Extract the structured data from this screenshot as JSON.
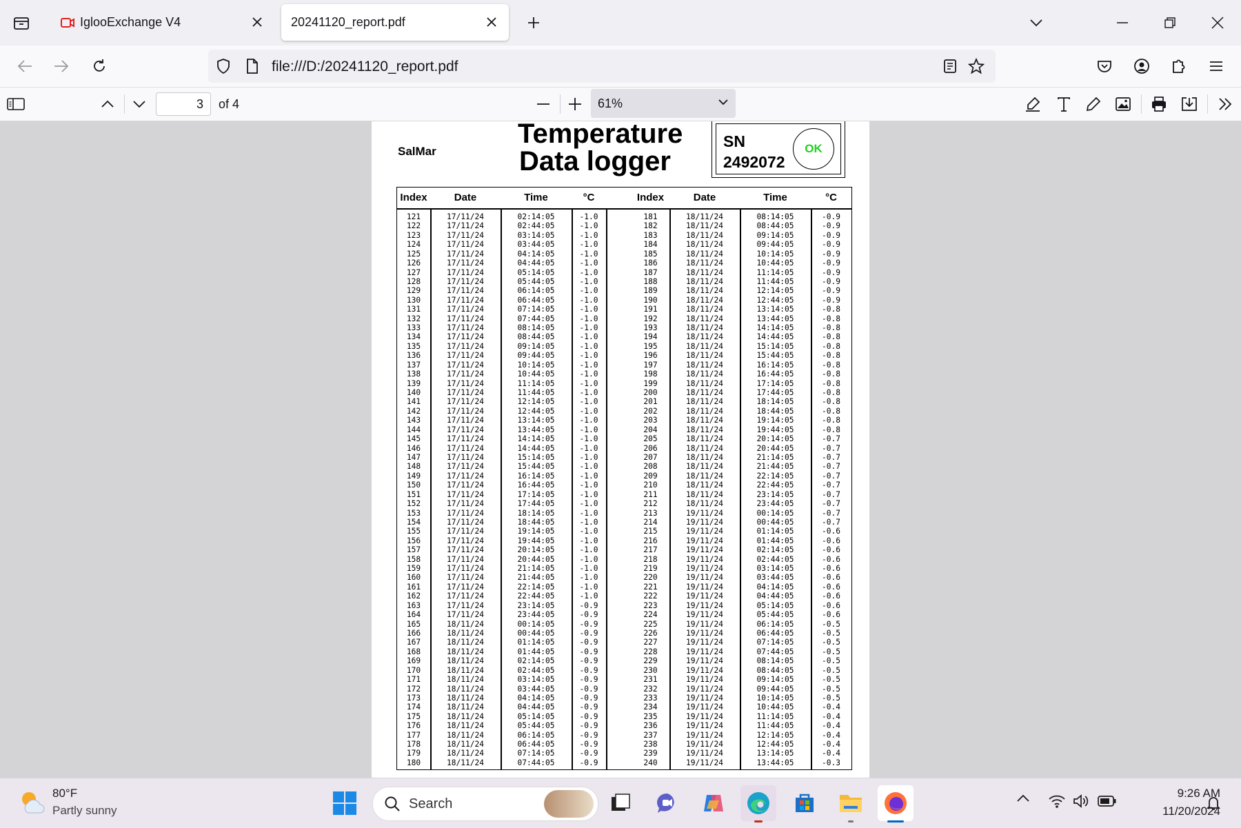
{
  "tabs": [
    {
      "title": "IglooExchange V4",
      "active": false
    },
    {
      "title": "20241120_report.pdf",
      "active": true
    }
  ],
  "url": "file:///D:/20241120_report.pdf",
  "pdf_toolbar": {
    "page": "3",
    "page_of": "of 4",
    "zoom": "61%"
  },
  "document": {
    "company": "SalMar",
    "title_line1": "Temperature",
    "title_line2": "Data logger",
    "sn_label": "SN",
    "sn_number": "2492072",
    "status": "OK",
    "headers": [
      "Index",
      "Date",
      "Time",
      "°C",
      "Index",
      "Date",
      "Time",
      "°C"
    ],
    "left": {
      "index": "121\n122\n123\n124\n125\n126\n127\n128\n129\n130\n131\n132\n133\n134\n135\n136\n137\n138\n139\n140\n141\n142\n143\n144\n145\n146\n147\n148\n149\n150\n151\n152\n153\n154\n155\n156\n157\n158\n159\n160\n161\n162\n163\n164\n165\n166\n167\n168\n169\n170\n171\n172\n173\n174\n175\n176\n177\n178\n179\n180",
      "date": "17/11/24\n17/11/24\n17/11/24\n17/11/24\n17/11/24\n17/11/24\n17/11/24\n17/11/24\n17/11/24\n17/11/24\n17/11/24\n17/11/24\n17/11/24\n17/11/24\n17/11/24\n17/11/24\n17/11/24\n17/11/24\n17/11/24\n17/11/24\n17/11/24\n17/11/24\n17/11/24\n17/11/24\n17/11/24\n17/11/24\n17/11/24\n17/11/24\n17/11/24\n17/11/24\n17/11/24\n17/11/24\n17/11/24\n17/11/24\n17/11/24\n17/11/24\n17/11/24\n17/11/24\n17/11/24\n17/11/24\n17/11/24\n17/11/24\n17/11/24\n17/11/24\n18/11/24\n18/11/24\n18/11/24\n18/11/24\n18/11/24\n18/11/24\n18/11/24\n18/11/24\n18/11/24\n18/11/24\n18/11/24\n18/11/24\n18/11/24\n18/11/24\n18/11/24\n18/11/24",
      "time": "02:14:05\n02:44:05\n03:14:05\n03:44:05\n04:14:05\n04:44:05\n05:14:05\n05:44:05\n06:14:05\n06:44:05\n07:14:05\n07:44:05\n08:14:05\n08:44:05\n09:14:05\n09:44:05\n10:14:05\n10:44:05\n11:14:05\n11:44:05\n12:14:05\n12:44:05\n13:14:05\n13:44:05\n14:14:05\n14:44:05\n15:14:05\n15:44:05\n16:14:05\n16:44:05\n17:14:05\n17:44:05\n18:14:05\n18:44:05\n19:14:05\n19:44:05\n20:14:05\n20:44:05\n21:14:05\n21:44:05\n22:14:05\n22:44:05\n23:14:05\n23:44:05\n00:14:05\n00:44:05\n01:14:05\n01:44:05\n02:14:05\n02:44:05\n03:14:05\n03:44:05\n04:14:05\n04:44:05\n05:14:05\n05:44:05\n06:14:05\n06:44:05\n07:14:05\n07:44:05",
      "temp": "-1.0\n-1.0\n-1.0\n-1.0\n-1.0\n-1.0\n-1.0\n-1.0\n-1.0\n-1.0\n-1.0\n-1.0\n-1.0\n-1.0\n-1.0\n-1.0\n-1.0\n-1.0\n-1.0\n-1.0\n-1.0\n-1.0\n-1.0\n-1.0\n-1.0\n-1.0\n-1.0\n-1.0\n-1.0\n-1.0\n-1.0\n-1.0\n-1.0\n-1.0\n-1.0\n-1.0\n-1.0\n-1.0\n-1.0\n-1.0\n-1.0\n-1.0\n-0.9\n-0.9\n-0.9\n-0.9\n-0.9\n-0.9\n-0.9\n-0.9\n-0.9\n-0.9\n-0.9\n-0.9\n-0.9\n-0.9\n-0.9\n-0.9\n-0.9\n-0.9"
    },
    "right": {
      "index": "181\n182\n183\n184\n185\n186\n187\n188\n189\n190\n191\n192\n193\n194\n195\n196\n197\n198\n199\n200\n201\n202\n203\n204\n205\n206\n207\n208\n209\n210\n211\n212\n213\n214\n215\n216\n217\n218\n219\n220\n221\n222\n223\n224\n225\n226\n227\n228\n229\n230\n231\n232\n233\n234\n235\n236\n237\n238\n239\n240",
      "date": "18/11/24\n18/11/24\n18/11/24\n18/11/24\n18/11/24\n18/11/24\n18/11/24\n18/11/24\n18/11/24\n18/11/24\n18/11/24\n18/11/24\n18/11/24\n18/11/24\n18/11/24\n18/11/24\n18/11/24\n18/11/24\n18/11/24\n18/11/24\n18/11/24\n18/11/24\n18/11/24\n18/11/24\n18/11/24\n18/11/24\n18/11/24\n18/11/24\n18/11/24\n18/11/24\n18/11/24\n18/11/24\n19/11/24\n19/11/24\n19/11/24\n19/11/24\n19/11/24\n19/11/24\n19/11/24\n19/11/24\n19/11/24\n19/11/24\n19/11/24\n19/11/24\n19/11/24\n19/11/24\n19/11/24\n19/11/24\n19/11/24\n19/11/24\n19/11/24\n19/11/24\n19/11/24\n19/11/24\n19/11/24\n19/11/24\n19/11/24\n19/11/24\n19/11/24\n19/11/24",
      "time": "08:14:05\n08:44:05\n09:14:05\n09:44:05\n10:14:05\n10:44:05\n11:14:05\n11:44:05\n12:14:05\n12:44:05\n13:14:05\n13:44:05\n14:14:05\n14:44:05\n15:14:05\n15:44:05\n16:14:05\n16:44:05\n17:14:05\n17:44:05\n18:14:05\n18:44:05\n19:14:05\n19:44:05\n20:14:05\n20:44:05\n21:14:05\n21:44:05\n22:14:05\n22:44:05\n23:14:05\n23:44:05\n00:14:05\n00:44:05\n01:14:05\n01:44:05\n02:14:05\n02:44:05\n03:14:05\n03:44:05\n04:14:05\n04:44:05\n05:14:05\n05:44:05\n06:14:05\n06:44:05\n07:14:05\n07:44:05\n08:14:05\n08:44:05\n09:14:05\n09:44:05\n10:14:05\n10:44:05\n11:14:05\n11:44:05\n12:14:05\n12:44:05\n13:14:05\n13:44:05",
      "temp": "-0.9\n-0.9\n-0.9\n-0.9\n-0.9\n-0.9\n-0.9\n-0.9\n-0.9\n-0.9\n-0.8\n-0.8\n-0.8\n-0.8\n-0.8\n-0.8\n-0.8\n-0.8\n-0.8\n-0.8\n-0.8\n-0.8\n-0.8\n-0.8\n-0.7\n-0.7\n-0.7\n-0.7\n-0.7\n-0.7\n-0.7\n-0.7\n-0.7\n-0.7\n-0.6\n-0.6\n-0.6\n-0.6\n-0.6\n-0.6\n-0.6\n-0.6\n-0.6\n-0.6\n-0.5\n-0.5\n-0.5\n-0.5\n-0.5\n-0.5\n-0.5\n-0.5\n-0.5\n-0.4\n-0.4\n-0.4\n-0.4\n-0.4\n-0.4\n-0.3"
    }
  },
  "taskbar": {
    "weather_temp": "80°F",
    "weather_desc": "Partly sunny",
    "search_placeholder": "Search",
    "time": "9:26 AM",
    "date": "11/20/2024"
  }
}
